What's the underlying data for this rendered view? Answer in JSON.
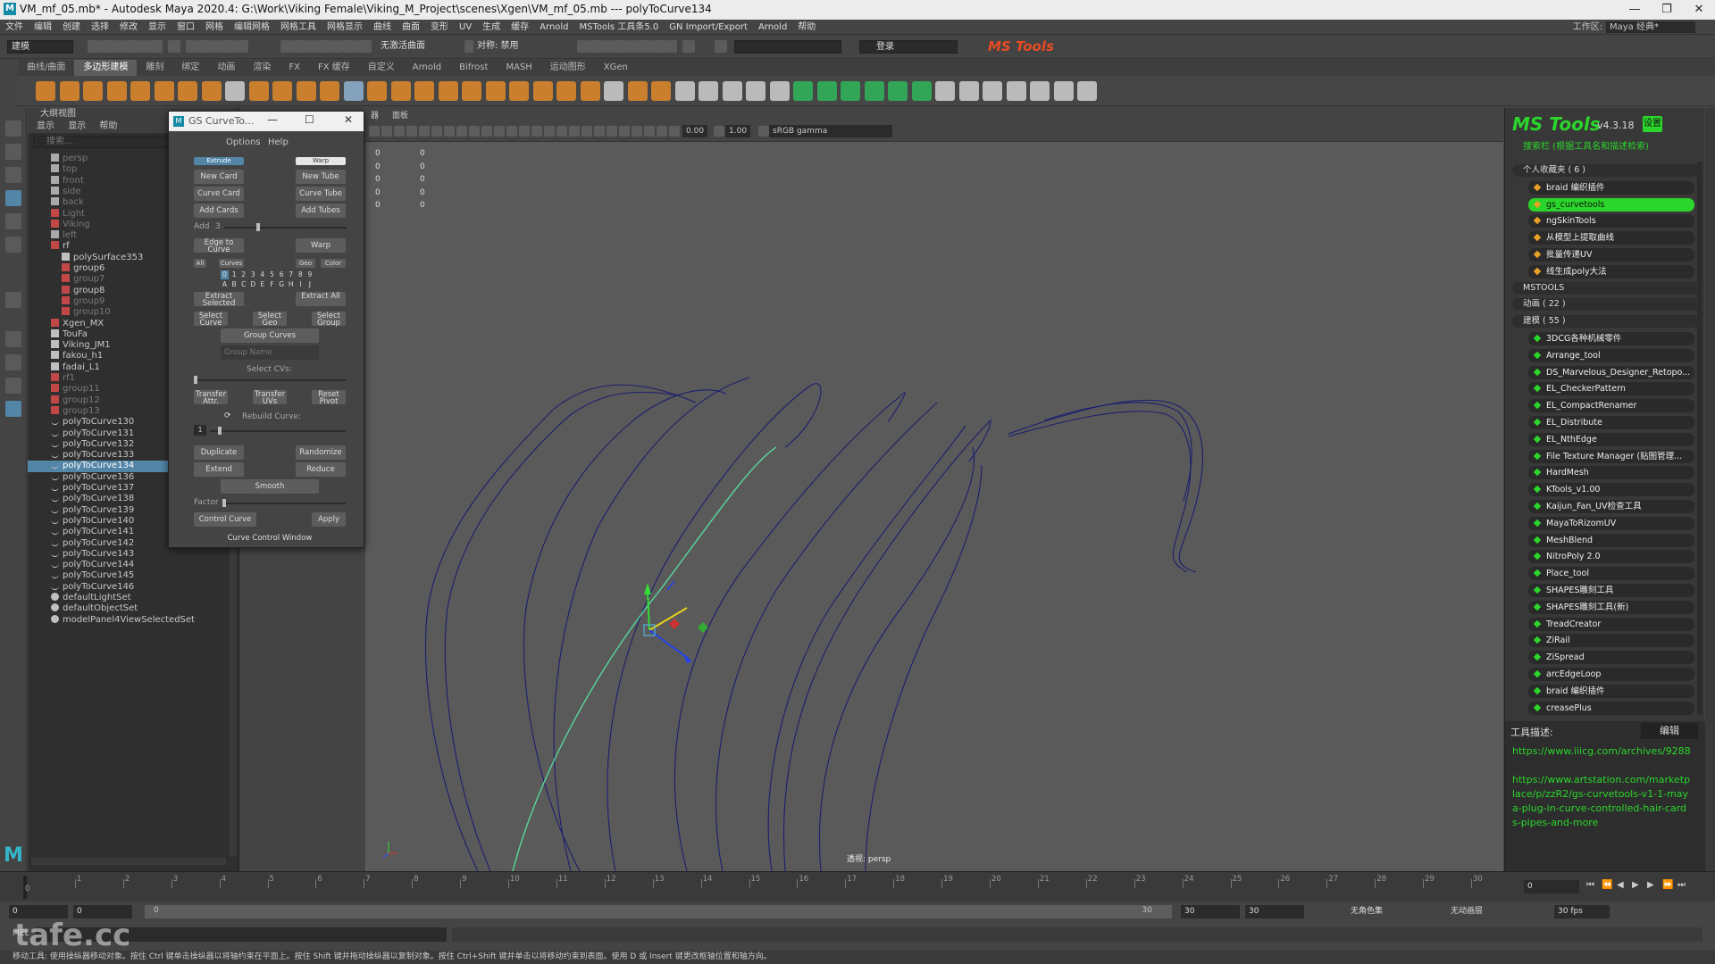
{
  "window": {
    "title": "VM_mf_05.mb* - Autodesk Maya 2020.4: G:\\Work\\Viking Female\\Viking_M_Project\\scenes\\Xgen\\VM_mf_05.mb  ---  polyToCurve134",
    "minimize": "—",
    "maximize": "❐",
    "close": "✕"
  },
  "menubar": {
    "items": [
      "文件",
      "编辑",
      "创建",
      "选择",
      "修改",
      "显示",
      "窗口",
      "网格",
      "编辑网格",
      "网格工具",
      "网格显示",
      "曲线",
      "曲面",
      "变形",
      "UV",
      "生成",
      "缓存",
      "Arnold",
      "MSTools 工具条5.0",
      "GN Import/Export",
      "Arnold",
      "帮助"
    ],
    "workspace_label": "工作区:",
    "workspace_value": "Maya 经典*"
  },
  "statusline": {
    "mode": "建模",
    "no_live": "无激活曲面",
    "symmetry": "对称: 禁用",
    "login": "登录",
    "brand": "MS Tools"
  },
  "shelf": {
    "tabs": [
      "曲线/曲面",
      "多边形建模",
      "雕刻",
      "绑定",
      "动画",
      "渲染",
      "FX",
      "FX 缓存",
      "自定义",
      "Arnold",
      "Bifrost",
      "MASH",
      "运动图形",
      "XGen"
    ],
    "active_tab": "多边形建模"
  },
  "outliner": {
    "title": "大纲视图",
    "menu": [
      "显示",
      "显示",
      "帮助"
    ],
    "search_placeholder": "搜索...",
    "rows": [
      {
        "label": "persp",
        "dim": true,
        "ind": 1,
        "icon": "camera"
      },
      {
        "label": "top",
        "dim": true,
        "ind": 1,
        "icon": "camera"
      },
      {
        "label": "front",
        "dim": true,
        "ind": 1,
        "icon": "camera"
      },
      {
        "label": "side",
        "dim": true,
        "ind": 1,
        "icon": "camera"
      },
      {
        "label": "back",
        "dim": true,
        "ind": 1,
        "icon": "camera"
      },
      {
        "label": "Light",
        "dim": true,
        "ind": 1,
        "icon": "group"
      },
      {
        "label": "Viking",
        "dim": true,
        "ind": 1,
        "icon": "group"
      },
      {
        "label": "left",
        "dim": true,
        "ind": 1,
        "icon": "camera"
      },
      {
        "label": "rf",
        "dim": false,
        "ind": 1,
        "icon": "group"
      },
      {
        "label": "polySurface353",
        "dim": false,
        "ind": 2,
        "icon": "mesh"
      },
      {
        "label": "group6",
        "dim": false,
        "ind": 2,
        "icon": "group"
      },
      {
        "label": "group7",
        "dim": true,
        "ind": 2,
        "icon": "group"
      },
      {
        "label": "group8",
        "dim": false,
        "ind": 2,
        "icon": "group"
      },
      {
        "label": "group9",
        "dim": true,
        "ind": 2,
        "icon": "group"
      },
      {
        "label": "group10",
        "dim": true,
        "ind": 2,
        "icon": "group"
      },
      {
        "label": "Xgen_MX",
        "dim": false,
        "ind": 1,
        "icon": "group"
      },
      {
        "label": "TouFa",
        "dim": false,
        "ind": 1,
        "icon": "mesh"
      },
      {
        "label": "Viking_JM1",
        "dim": false,
        "ind": 1,
        "icon": "mesh"
      },
      {
        "label": "fakou_h1",
        "dim": false,
        "ind": 1,
        "icon": "mesh"
      },
      {
        "label": "fadai_L1",
        "dim": false,
        "ind": 1,
        "icon": "mesh"
      },
      {
        "label": "rf1",
        "dim": true,
        "ind": 1,
        "icon": "group"
      },
      {
        "label": "group11",
        "dim": true,
        "ind": 1,
        "icon": "group"
      },
      {
        "label": "group12",
        "dim": true,
        "ind": 1,
        "icon": "group"
      },
      {
        "label": "group13",
        "dim": true,
        "ind": 1,
        "icon": "group"
      },
      {
        "label": "polyToCurve130",
        "dim": false,
        "ind": 1,
        "icon": "curve"
      },
      {
        "label": "polyToCurve131",
        "dim": false,
        "ind": 1,
        "icon": "curve"
      },
      {
        "label": "polyToCurve132",
        "dim": false,
        "ind": 1,
        "icon": "curve"
      },
      {
        "label": "polyToCurve133",
        "dim": false,
        "ind": 1,
        "icon": "curve"
      },
      {
        "label": "polyToCurve134",
        "dim": false,
        "ind": 1,
        "icon": "curve",
        "sel": true
      },
      {
        "label": "polyToCurve136",
        "dim": false,
        "ind": 1,
        "icon": "curve"
      },
      {
        "label": "polyToCurve137",
        "dim": false,
        "ind": 1,
        "icon": "curve"
      },
      {
        "label": "polyToCurve138",
        "dim": false,
        "ind": 1,
        "icon": "curve"
      },
      {
        "label": "polyToCurve139",
        "dim": false,
        "ind": 1,
        "icon": "curve"
      },
      {
        "label": "polyToCurve140",
        "dim": false,
        "ind": 1,
        "icon": "curve"
      },
      {
        "label": "polyToCurve141",
        "dim": false,
        "ind": 1,
        "icon": "curve"
      },
      {
        "label": "polyToCurve142",
        "dim": false,
        "ind": 1,
        "icon": "curve"
      },
      {
        "label": "polyToCurve143",
        "dim": false,
        "ind": 1,
        "icon": "curve"
      },
      {
        "label": "polyToCurve144",
        "dim": false,
        "ind": 1,
        "icon": "curve"
      },
      {
        "label": "polyToCurve145",
        "dim": false,
        "ind": 1,
        "icon": "curve"
      },
      {
        "label": "polyToCurve146",
        "dim": false,
        "ind": 1,
        "icon": "curve"
      },
      {
        "label": "defaultLightSet",
        "dim": false,
        "ind": 1,
        "icon": "set"
      },
      {
        "label": "defaultObjectSet",
        "dim": false,
        "ind": 1,
        "icon": "set"
      },
      {
        "label": "modelPanel4ViewSelectedSet",
        "dim": false,
        "ind": 1,
        "icon": "set"
      }
    ]
  },
  "gs": {
    "title": "GS CurveTo...",
    "menu_options": "Options",
    "menu_help": "Help",
    "extrude": "Extrude",
    "warp_toggle": "Warp",
    "new_card": "New Card",
    "new_tube": "New Tube",
    "curve_card": "Curve Card",
    "curve_tube": "Curve Tube",
    "add_cards": "Add Cards",
    "add_tubes": "Add Tubes",
    "add_label": "Add",
    "add_value": "3",
    "edge_to_curve": "Edge to Curve",
    "warp": "Warp",
    "all": "All",
    "curves": "Curves",
    "geo": "Geo",
    "color": "Color",
    "layers_numbers": [
      "0",
      "1",
      "2",
      "3",
      "4",
      "5",
      "6",
      "7",
      "8",
      "9"
    ],
    "layers_letters": [
      "A",
      "B",
      "C",
      "D",
      "E",
      "F",
      "G",
      "H",
      "I",
      "J"
    ],
    "extract_selected": "Extract Selected",
    "extract_all": "Extract All",
    "select_curve": "Select Curve",
    "select_geo": "Select Geo",
    "select_group": "Select Group",
    "group_curves": "Group Curves",
    "group_name_placeholder": "Group Name",
    "select_cvs": "Select CVs:",
    "transfer_attr": "Transfer Attr.",
    "transfer_uvs": "Transfer UVs",
    "reset_pivot": "Reset Pivot",
    "rebuild_curve": "Rebuild Curve:",
    "rebuild_value": "1",
    "duplicate": "Duplicate",
    "randomize": "Randomize",
    "extend": "Extend",
    "reduce": "Reduce",
    "smooth": "Smooth",
    "factor": "Factor",
    "control_curve": "Control Curve",
    "apply": "Apply",
    "curve_control_window": "Curve Control Window"
  },
  "viewport": {
    "menu": [
      "器",
      "面板"
    ],
    "exposure": "0.00",
    "gamma": "1.00",
    "colorspace": "sRGB gamma",
    "hud_col1": [
      "0",
      "0",
      "0",
      "0",
      "0"
    ],
    "hud_col2": [
      "0",
      "0",
      "0",
      "0",
      "0"
    ],
    "camera": "透视: persp"
  },
  "mstools": {
    "logo": "MS Tools",
    "version": "v4.3.18",
    "settings": "设置",
    "search": "搜索栏 (根据工具名和描述检索)",
    "favorites_header": "个人收藏夹 ( 6 )",
    "favorites": [
      "braid 编织插件",
      "gs_curvetools",
      "ngSkinTools",
      "从模型上提取曲线",
      "批量传递UV",
      "线生成poly大法"
    ],
    "highlighted": "gs_curvetools",
    "mstools_header": "MSTOOLS",
    "anim_header": "动画 ( 22 )",
    "model_header": "建模 ( 55 )",
    "model_items": [
      "3DCG各种机械零件",
      "Arrange_tool",
      "DS_Marvelous_Designer_Retopo...",
      "EL_CheckerPattern",
      "EL_CompactRenamer",
      "EL_Distribute",
      "EL_NthEdge",
      "File Texture Manager (贴图管理...",
      "HardMesh",
      "KTools_v1.00",
      "Kaijun_Fan_UV检查工具",
      "MayaToRizomUV",
      "MeshBlend",
      "NitroPoly 2.0",
      "Place_tool",
      "SHAPES雕刻工具",
      "SHAPES雕刻工具(新)",
      "TreadCreator",
      "ZiRail",
      "ZiSpread",
      "arcEdgeLoop",
      "braid 编织插件",
      "creasePlus"
    ],
    "desc_label": "工具描述:",
    "edit": "编辑",
    "desc_text": "https://www.iiicg.com/archives/9288\n\nhttps://www.artstation.com/marketplace/p/zzR2/gs-curvetools-v1-1-maya-plug-in-curve-controlled-hair-cards-pipes-and-more"
  },
  "timeline": {
    "ticks": [
      "1",
      "2",
      "3",
      "4",
      "5",
      "6",
      "7",
      "8",
      "9",
      "10",
      "11",
      "12",
      "13",
      "14",
      "15",
      "16",
      "17",
      "18",
      "19",
      "20",
      "21",
      "22",
      "23",
      "24",
      "25",
      "26",
      "27",
      "28",
      "29",
      "30"
    ],
    "current_frame": "0",
    "start": "0",
    "range_start": "0",
    "range_inner": "0",
    "range_end_a": "30",
    "range_end_b": "30",
    "end": "30",
    "char_set": "无角色集",
    "anim_layer": "无动画层",
    "fps": "30 fps"
  },
  "cmdline": {
    "mel": "MEL"
  },
  "helpline": "移动工具: 使用操纵器移动对象。按住 Ctrl 键单击操纵器以将轴约束在平面上。按住 Shift 键并拖动操纵器以复制对象。按住 Ctrl+Shift 键并单击以将移动约束到表面。使用 D 或 Insert 键更改枢轴位置和轴方向。",
  "watermark": "tafe.cc",
  "colors": {
    "accent_green": "#2bd52b",
    "selection_blue": "#5285a6",
    "mstools_orange": "#e84b22",
    "curve_navy": "#1c1f6e",
    "curve_highlight": "#58e0a0"
  }
}
